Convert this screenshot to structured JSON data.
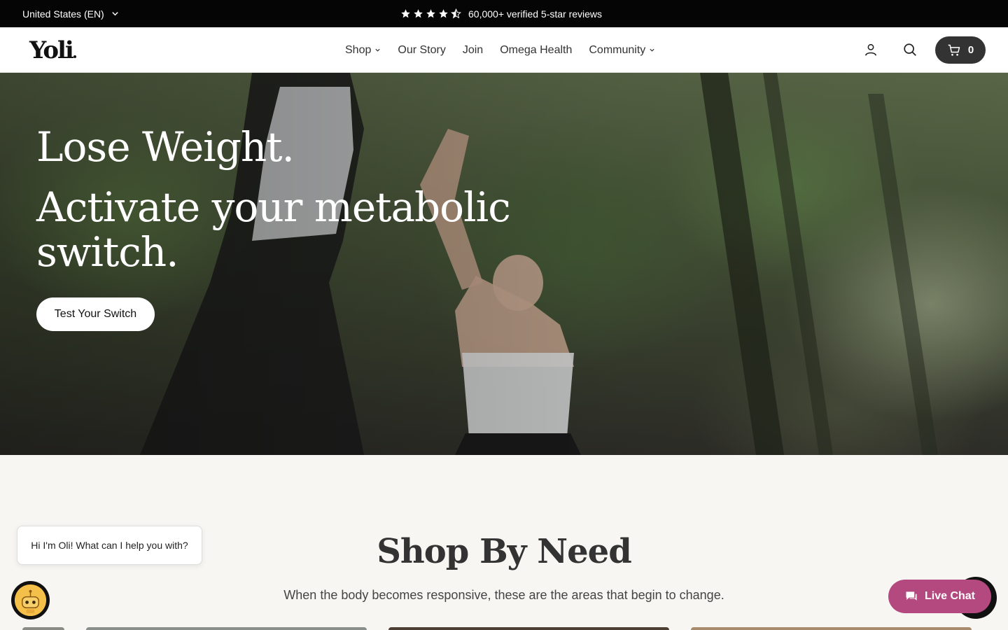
{
  "topbar": {
    "region": "United States (EN)",
    "reviews_text": "60,000+ verified 5-star reviews",
    "rating_stars": 4.5
  },
  "header": {
    "logo": "Yoli",
    "nav": [
      "Shop",
      "Our Story",
      "Join",
      "Omega Health",
      "Community"
    ],
    "cart_count": "0"
  },
  "hero": {
    "headline_1": "Lose Weight.",
    "headline_2": "Activate your metabolic switch.",
    "cta": "Test Your Switch"
  },
  "shop_by_need": {
    "title": "Shop By Need",
    "subtitle": "When the body becomes responsive, these are the areas that begin to change."
  },
  "chat": {
    "bot_message": "Hi I'm Oli! What can I help you with?",
    "live_chat_label": "Live Chat",
    "accent": "#b3497e"
  }
}
